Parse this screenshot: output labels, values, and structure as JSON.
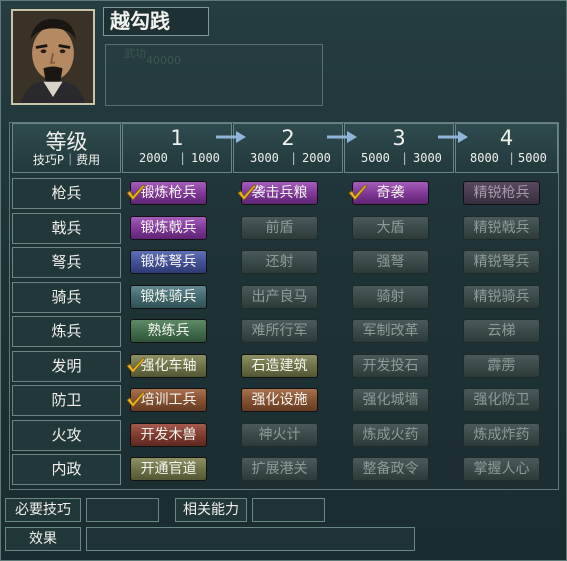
{
  "general": {
    "name": "越勾践",
    "faint_line1": "武功",
    "faint_line2": "40000"
  },
  "header": {
    "level_label": "等级",
    "skill_cost_label": "技巧P｜费用",
    "tiers": [
      {
        "num": "1",
        "skill": "2000",
        "cost": "1000"
      },
      {
        "num": "2",
        "skill": "3000",
        "cost": "2000"
      },
      {
        "num": "3",
        "skill": "5000",
        "cost": "3000"
      },
      {
        "num": "4",
        "skill": "8000",
        "cost": "5000"
      }
    ]
  },
  "rows": [
    {
      "label": "枪兵",
      "techs": [
        {
          "text": "锻炼枪兵",
          "color": "purple",
          "learned": true
        },
        {
          "text": "袭击兵粮",
          "color": "purple",
          "learned": true
        },
        {
          "text": "奇袭",
          "color": "purple",
          "learned": true
        },
        {
          "text": "精锐枪兵",
          "color": "dim-purple",
          "learned": false
        }
      ]
    },
    {
      "label": "戟兵",
      "techs": [
        {
          "text": "锻炼戟兵",
          "color": "purple",
          "learned": false
        },
        {
          "text": "前盾",
          "color": "dim",
          "learned": false
        },
        {
          "text": "大盾",
          "color": "dim",
          "learned": false
        },
        {
          "text": "精锐戟兵",
          "color": "dim",
          "learned": false
        }
      ]
    },
    {
      "label": "弩兵",
      "techs": [
        {
          "text": "锻炼弩兵",
          "color": "blue",
          "learned": false
        },
        {
          "text": "还射",
          "color": "dim",
          "learned": false
        },
        {
          "text": "强弩",
          "color": "dim",
          "learned": false
        },
        {
          "text": "精锐弩兵",
          "color": "dim",
          "learned": false
        }
      ]
    },
    {
      "label": "骑兵",
      "techs": [
        {
          "text": "锻炼骑兵",
          "color": "teal",
          "learned": false
        },
        {
          "text": "出产良马",
          "color": "dim",
          "learned": false
        },
        {
          "text": "骑射",
          "color": "dim",
          "learned": false
        },
        {
          "text": "精锐骑兵",
          "color": "dim",
          "learned": false
        }
      ]
    },
    {
      "label": "炼兵",
      "techs": [
        {
          "text": "熟练兵",
          "color": "green",
          "learned": false
        },
        {
          "text": "难所行军",
          "color": "dim",
          "learned": false
        },
        {
          "text": "军制改革",
          "color": "dim",
          "learned": false
        },
        {
          "text": "云梯",
          "color": "dim",
          "learned": false
        }
      ]
    },
    {
      "label": "发明",
      "techs": [
        {
          "text": "强化车轴",
          "color": "olive",
          "learned": true
        },
        {
          "text": "石造建筑",
          "color": "olive",
          "learned": false
        },
        {
          "text": "开发投石",
          "color": "dim",
          "learned": false
        },
        {
          "text": "霹雳",
          "color": "dim",
          "learned": false
        }
      ]
    },
    {
      "label": "防卫",
      "techs": [
        {
          "text": "培训工兵",
          "color": "brown",
          "learned": true
        },
        {
          "text": "强化设施",
          "color": "brown",
          "learned": false
        },
        {
          "text": "强化城墙",
          "color": "dim",
          "learned": false
        },
        {
          "text": "强化防卫",
          "color": "dim",
          "learned": false
        }
      ]
    },
    {
      "label": "火攻",
      "techs": [
        {
          "text": "开发木兽",
          "color": "red",
          "learned": false
        },
        {
          "text": "神火计",
          "color": "dim",
          "learned": false
        },
        {
          "text": "炼成火药",
          "color": "dim",
          "learned": false
        },
        {
          "text": "炼成炸药",
          "color": "dim",
          "learned": false
        }
      ]
    },
    {
      "label": "内政",
      "techs": [
        {
          "text": "开通官道",
          "color": "olive",
          "learned": false
        },
        {
          "text": "扩展港关",
          "color": "dim",
          "learned": false
        },
        {
          "text": "整备政令",
          "color": "dim",
          "learned": false
        },
        {
          "text": "掌握人心",
          "color": "dim",
          "learned": false
        }
      ]
    }
  ],
  "footer": {
    "required_skill_label": "必要技巧",
    "related_ability_label": "相关能力",
    "effect_label": "效果"
  },
  "colors": {
    "check": "#e8b423",
    "arrow": "#8fb6d8"
  }
}
